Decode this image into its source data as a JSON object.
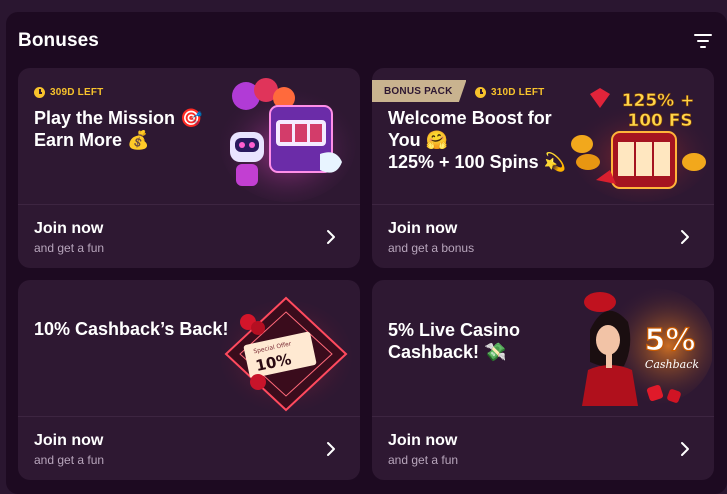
{
  "header": {
    "title": "Bonuses",
    "filter_icon": "filter-icon"
  },
  "cards": [
    {
      "timer": "309D LEFT",
      "title": "Play the Mission 🎯\nEarn More 💰",
      "cta": "Join now",
      "cta_sub": "and get a fun"
    },
    {
      "badge": "BONUS PACK",
      "timer": "310D LEFT",
      "title": "Welcome Boost for\nYou 🤗\n125% + 100 Spins 💫",
      "art_text_1": "125% +",
      "art_text_2": "100 FS",
      "cta": "Join now",
      "cta_sub": "and get a bonus"
    },
    {
      "title": "10% Cashback’s Back!",
      "art_text": "10%",
      "art_small": "Special Offer",
      "cta": "Join now",
      "cta_sub": "and get a fun"
    },
    {
      "title": "5% Live Casino\nCashback! 💸",
      "art_text": "5%",
      "art_small": "Cashback",
      "cta": "Join now",
      "cta_sub": "and get a fun"
    }
  ],
  "colors": {
    "accent": "#f7c22c",
    "card_bg": "#2e1832",
    "badge_bg": "#c9b38f"
  }
}
